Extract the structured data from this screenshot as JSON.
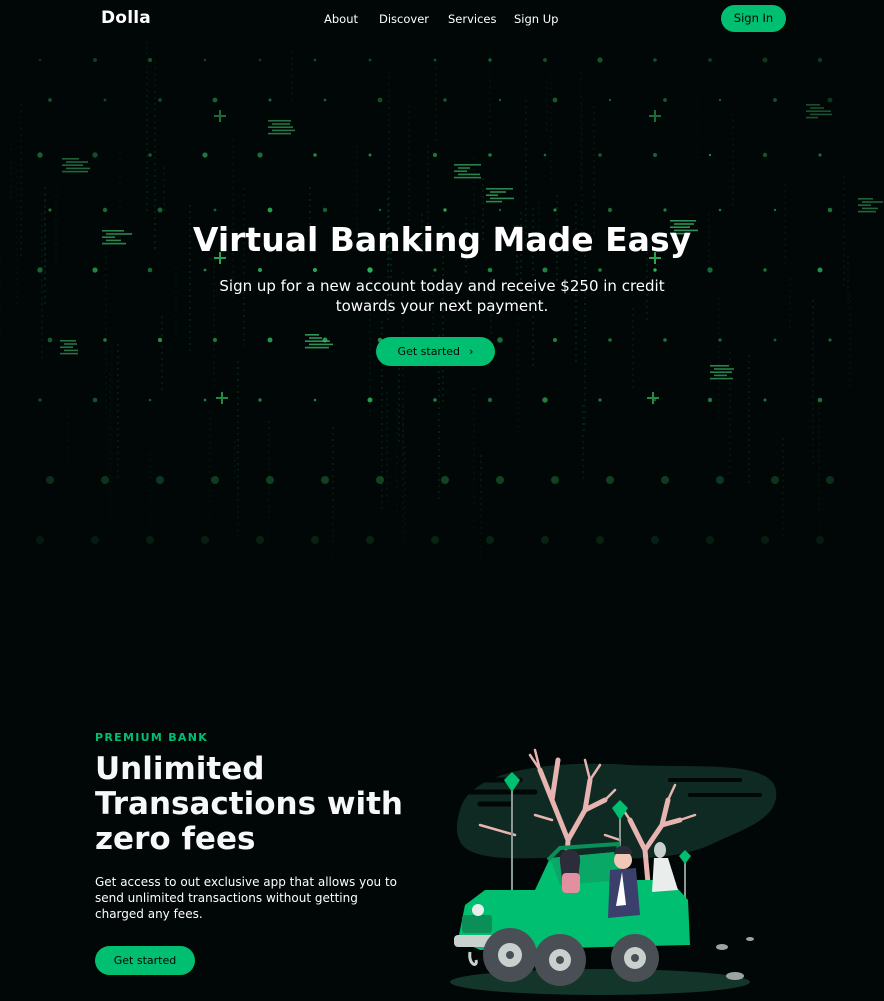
{
  "nav": {
    "logo": "Dolla",
    "links": [
      "About",
      "Discover",
      "Services",
      "Sign Up"
    ],
    "signin": "Sign In"
  },
  "hero": {
    "title": "Virtual Banking Made Easy",
    "subtitle": "Sign up for a new account today and receive $250 in credit towards your next payment.",
    "button": "Get started"
  },
  "info": {
    "topline": "PREMIUM BANK",
    "heading": "Unlimited Transactions with zero fees",
    "description": "Get access to out exclusive app that allows you to send unlimited transactions without getting charged any fees.",
    "button": "Get started"
  },
  "colors": {
    "background": "#010606",
    "accent": "#01bf71",
    "text": "#ffffff"
  },
  "icons": {
    "hero_button_arrow": "chevron-right-icon",
    "illustration": "jeep-couple-illustration"
  }
}
